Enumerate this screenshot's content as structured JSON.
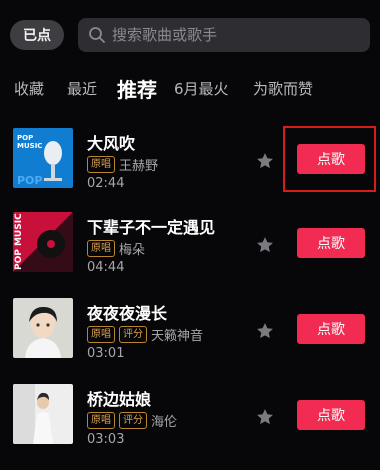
{
  "header": {
    "played_label": "已点",
    "search_placeholder": "搜索歌曲或歌手"
  },
  "tabs": [
    {
      "label": "收藏",
      "active": false
    },
    {
      "label": "最近",
      "active": false
    },
    {
      "label": "推荐",
      "active": true
    },
    {
      "label": "6月最火",
      "active": false
    },
    {
      "label": "为歌而赞",
      "active": false
    }
  ],
  "songs": [
    {
      "title": "大风吹",
      "tags": [
        "原唱"
      ],
      "artist": "王赫野",
      "duration": "02:44",
      "cover_text": [
        "POP",
        "MUSIC"
      ],
      "button": "点歌"
    },
    {
      "title": "下辈子不一定遇见",
      "tags": [
        "原唱"
      ],
      "artist": "梅朵",
      "duration": "04:44",
      "cover_text": [
        "POP MUSIC"
      ],
      "button": "点歌"
    },
    {
      "title": "夜夜夜漫长",
      "tags": [
        "原唱",
        "评分"
      ],
      "artist": "天籁神音",
      "duration": "03:01",
      "button": "点歌"
    },
    {
      "title": "桥边姑娘",
      "tags": [
        "原唱",
        "评分"
      ],
      "artist": "海伦",
      "duration": "03:03",
      "button": "点歌"
    }
  ],
  "colors": {
    "accent": "#f22b52",
    "highlight": "#d71c1c",
    "tag": "#d9a14a",
    "background": "#070709"
  }
}
